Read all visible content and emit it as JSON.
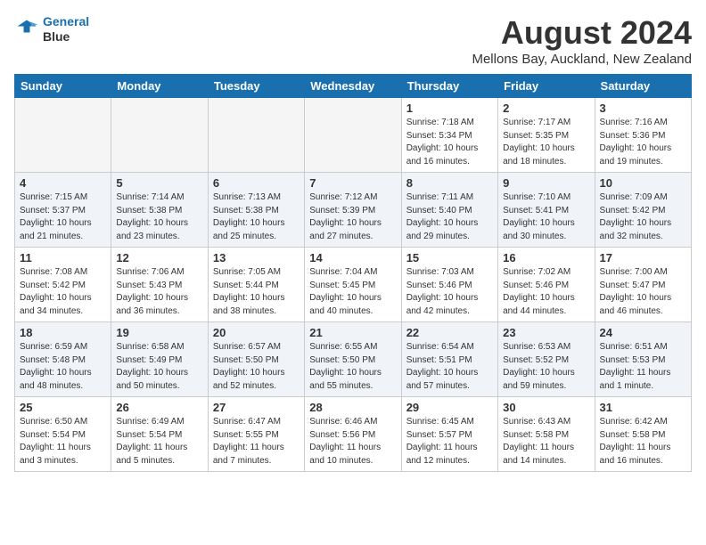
{
  "header": {
    "logo_line1": "General",
    "logo_line2": "Blue",
    "month": "August 2024",
    "location": "Mellons Bay, Auckland, New Zealand"
  },
  "weekdays": [
    "Sunday",
    "Monday",
    "Tuesday",
    "Wednesday",
    "Thursday",
    "Friday",
    "Saturday"
  ],
  "weeks": [
    [
      {
        "day": "",
        "empty": true
      },
      {
        "day": "",
        "empty": true
      },
      {
        "day": "",
        "empty": true
      },
      {
        "day": "",
        "empty": true
      },
      {
        "day": "1",
        "sunrise": "7:18 AM",
        "sunset": "5:34 PM",
        "daylight": "10 hours and 16 minutes."
      },
      {
        "day": "2",
        "sunrise": "7:17 AM",
        "sunset": "5:35 PM",
        "daylight": "10 hours and 18 minutes."
      },
      {
        "day": "3",
        "sunrise": "7:16 AM",
        "sunset": "5:36 PM",
        "daylight": "10 hours and 19 minutes."
      }
    ],
    [
      {
        "day": "4",
        "sunrise": "7:15 AM",
        "sunset": "5:37 PM",
        "daylight": "10 hours and 21 minutes."
      },
      {
        "day": "5",
        "sunrise": "7:14 AM",
        "sunset": "5:38 PM",
        "daylight": "10 hours and 23 minutes."
      },
      {
        "day": "6",
        "sunrise": "7:13 AM",
        "sunset": "5:38 PM",
        "daylight": "10 hours and 25 minutes."
      },
      {
        "day": "7",
        "sunrise": "7:12 AM",
        "sunset": "5:39 PM",
        "daylight": "10 hours and 27 minutes."
      },
      {
        "day": "8",
        "sunrise": "7:11 AM",
        "sunset": "5:40 PM",
        "daylight": "10 hours and 29 minutes."
      },
      {
        "day": "9",
        "sunrise": "7:10 AM",
        "sunset": "5:41 PM",
        "daylight": "10 hours and 30 minutes."
      },
      {
        "day": "10",
        "sunrise": "7:09 AM",
        "sunset": "5:42 PM",
        "daylight": "10 hours and 32 minutes."
      }
    ],
    [
      {
        "day": "11",
        "sunrise": "7:08 AM",
        "sunset": "5:42 PM",
        "daylight": "10 hours and 34 minutes."
      },
      {
        "day": "12",
        "sunrise": "7:06 AM",
        "sunset": "5:43 PM",
        "daylight": "10 hours and 36 minutes."
      },
      {
        "day": "13",
        "sunrise": "7:05 AM",
        "sunset": "5:44 PM",
        "daylight": "10 hours and 38 minutes."
      },
      {
        "day": "14",
        "sunrise": "7:04 AM",
        "sunset": "5:45 PM",
        "daylight": "10 hours and 40 minutes."
      },
      {
        "day": "15",
        "sunrise": "7:03 AM",
        "sunset": "5:46 PM",
        "daylight": "10 hours and 42 minutes."
      },
      {
        "day": "16",
        "sunrise": "7:02 AM",
        "sunset": "5:46 PM",
        "daylight": "10 hours and 44 minutes."
      },
      {
        "day": "17",
        "sunrise": "7:00 AM",
        "sunset": "5:47 PM",
        "daylight": "10 hours and 46 minutes."
      }
    ],
    [
      {
        "day": "18",
        "sunrise": "6:59 AM",
        "sunset": "5:48 PM",
        "daylight": "10 hours and 48 minutes."
      },
      {
        "day": "19",
        "sunrise": "6:58 AM",
        "sunset": "5:49 PM",
        "daylight": "10 hours and 50 minutes."
      },
      {
        "day": "20",
        "sunrise": "6:57 AM",
        "sunset": "5:50 PM",
        "daylight": "10 hours and 52 minutes."
      },
      {
        "day": "21",
        "sunrise": "6:55 AM",
        "sunset": "5:50 PM",
        "daylight": "10 hours and 55 minutes."
      },
      {
        "day": "22",
        "sunrise": "6:54 AM",
        "sunset": "5:51 PM",
        "daylight": "10 hours and 57 minutes."
      },
      {
        "day": "23",
        "sunrise": "6:53 AM",
        "sunset": "5:52 PM",
        "daylight": "10 hours and 59 minutes."
      },
      {
        "day": "24",
        "sunrise": "6:51 AM",
        "sunset": "5:53 PM",
        "daylight": "11 hours and 1 minute."
      }
    ],
    [
      {
        "day": "25",
        "sunrise": "6:50 AM",
        "sunset": "5:54 PM",
        "daylight": "11 hours and 3 minutes."
      },
      {
        "day": "26",
        "sunrise": "6:49 AM",
        "sunset": "5:54 PM",
        "daylight": "11 hours and 5 minutes."
      },
      {
        "day": "27",
        "sunrise": "6:47 AM",
        "sunset": "5:55 PM",
        "daylight": "11 hours and 7 minutes."
      },
      {
        "day": "28",
        "sunrise": "6:46 AM",
        "sunset": "5:56 PM",
        "daylight": "11 hours and 10 minutes."
      },
      {
        "day": "29",
        "sunrise": "6:45 AM",
        "sunset": "5:57 PM",
        "daylight": "11 hours and 12 minutes."
      },
      {
        "day": "30",
        "sunrise": "6:43 AM",
        "sunset": "5:58 PM",
        "daylight": "11 hours and 14 minutes."
      },
      {
        "day": "31",
        "sunrise": "6:42 AM",
        "sunset": "5:58 PM",
        "daylight": "11 hours and 16 minutes."
      }
    ]
  ]
}
